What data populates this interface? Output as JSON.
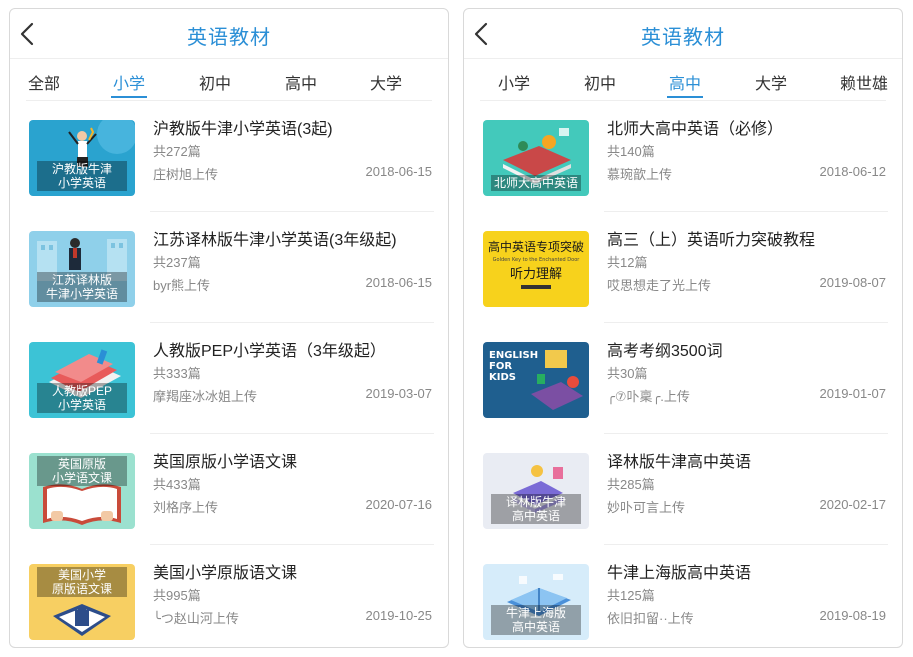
{
  "left": {
    "title": "英语教材",
    "tabs": [
      {
        "label": "全部"
      },
      {
        "label": "小学",
        "active": true
      },
      {
        "label": "初中"
      },
      {
        "label": "高中"
      },
      {
        "label": "大学"
      }
    ],
    "items": [
      {
        "title": "沪教版牛津小学英语(3起)",
        "count": "共272篇",
        "uploader": "庄树旭上传",
        "date": "2018-06-15",
        "thumb_label": "沪教版牛津\n小学英语",
        "thumb_color": "#2aa3cf"
      },
      {
        "title": "江苏译林版牛津小学英语(3年级起)",
        "count": "共237篇",
        "uploader": "byr熊上传",
        "date": "2018-06-15",
        "thumb_label": "江苏译林版\n牛津小学英语",
        "thumb_color": "#8fd0ea"
      },
      {
        "title": "人教版PEP小学英语（3年级起）",
        "count": "共333篇",
        "uploader": "摩羯座冰冰姐上传",
        "date": "2019-03-07",
        "thumb_label": "人教版PEP\n小学英语",
        "thumb_color": "#3cc3d6"
      },
      {
        "title": "英国原版小学语文课",
        "count": "共433篇",
        "uploader": "刘格序上传",
        "date": "2020-07-16",
        "thumb_label": "英国原版\n小学语文课",
        "thumb_color": "#9be1cf"
      },
      {
        "title": "美国小学原版语文课",
        "count": "共995篇",
        "uploader": "╰つ赵山河上传",
        "date": "2019-10-25",
        "thumb_label": "美国小学\n原版语文课",
        "thumb_color": "#f7cf62"
      }
    ]
  },
  "right": {
    "title": "英语教材",
    "tabs": [
      {
        "label": "小学"
      },
      {
        "label": "初中"
      },
      {
        "label": "高中",
        "active": true
      },
      {
        "label": "大学"
      },
      {
        "label": "赖世雄"
      }
    ],
    "items": [
      {
        "title": "北师大高中英语（必修）",
        "count": "共140篇",
        "uploader": "慕琬歆上传",
        "date": "2018-06-12",
        "thumb_label": "北师大高中英语",
        "thumb_color": "#43c9bb"
      },
      {
        "title": "高三（上）英语听力突破教程",
        "count": "共12篇",
        "uploader": "哎思想走了光上传",
        "date": "2019-08-07",
        "thumb_label": "",
        "thumb_color": "#f7d21c",
        "cover_line1": "高中英语专项突破",
        "cover_sub": "Golden Key to the Enchanted Door",
        "cover_line2": "听力理解"
      },
      {
        "title": "高考考纲3500词",
        "count": "共30篇",
        "uploader": "╭⑦卟稟╭.上传",
        "date": "2019-01-07",
        "thumb_label": "",
        "thumb_color": "#1f5f8f",
        "cover_text": "ENGLISH\nFOR\nKIDS"
      },
      {
        "title": "译林版牛津高中英语",
        "count": "共285篇",
        "uploader": "妙卟可言上传",
        "date": "2020-02-17",
        "thumb_label": "译林版牛津\n高中英语",
        "thumb_color": "#e9ecf3"
      },
      {
        "title": "牛津上海版高中英语",
        "count": "共125篇",
        "uploader": "依旧扣留··上传",
        "date": "2019-08-19",
        "thumb_label": "牛津上海版\n高中英语",
        "thumb_color": "#d6ecfa"
      }
    ]
  }
}
